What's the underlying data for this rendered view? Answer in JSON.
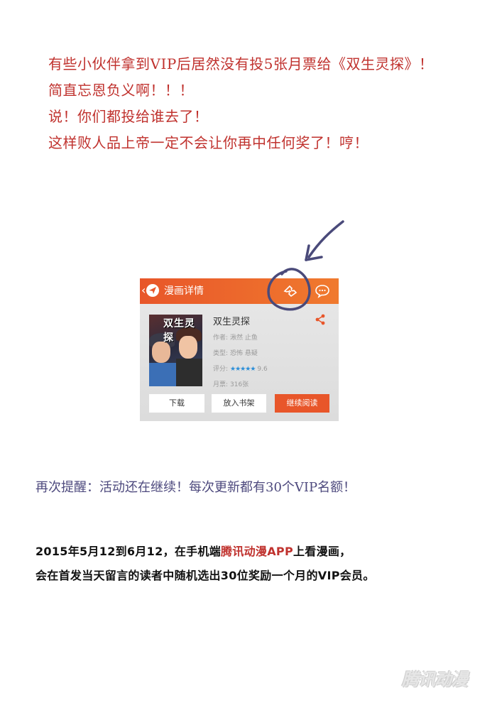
{
  "intro_lines": [
    "有些小伙伴拿到VIP后居然没有投5张月票给《双生灵探》！",
    "简直忘恩负义啊！！！",
    "说！你们都投给谁去了！",
    "这样败人品上帝一定不会让你再中任何奖了！哼！"
  ],
  "phone": {
    "header_title": "漫画详情",
    "comic_title": "双生灵探",
    "cover_title": "双生灵探",
    "author_label": "作者:",
    "author_value": "湫然 止鱼",
    "type_label": "类型:",
    "type_value": "恐怖 悬疑",
    "rating_label": "评分:",
    "rating_stars": "★★★★★",
    "rating_value": "9.6",
    "tickets_label": "月票:",
    "tickets_value": "316张",
    "btn_download": "下载",
    "btn_shelf": "放入书架",
    "btn_continue": "继续阅读",
    "accent_color": "#e8562a",
    "star_color": "#2c8fd8",
    "icons": [
      "back-arrow-icon",
      "ticket-icon",
      "chat-icon",
      "share-icon"
    ]
  },
  "reminder": "再次提醒：活动还在继续！每次更新都有30个VIP名额！",
  "event": {
    "line1_pre": "2015年5月12到6月12，在手机端",
    "line1_app": "腾讯动漫APP",
    "line1_post": "上看漫画，",
    "line2": "会在首发当天留言的读者中随机选出30位奖励一个月的VIP会员。"
  },
  "watermark": "腾讯动漫",
  "colors": {
    "intro_text": "#c0322e",
    "reminder_text": "#4e4a7e",
    "highlight": "#c0322e",
    "annotation_ink": "#4a4a7a"
  }
}
